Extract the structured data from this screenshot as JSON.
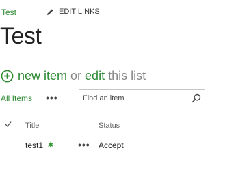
{
  "breadcrumb": {
    "site_link": "Test",
    "edit_links_label": "EDIT LINKS"
  },
  "page": {
    "title": "Test"
  },
  "command_bar": {
    "new_item_label": "new item",
    "or_text": "or",
    "edit_label": "edit",
    "this_list_label": "this list"
  },
  "views": {
    "current_view": "All Items",
    "more_label": "•••"
  },
  "search": {
    "placeholder": "Find an item"
  },
  "table": {
    "columns": [
      "Title",
      "Status"
    ],
    "rows": [
      {
        "title": "test1",
        "status": "Accept",
        "menu_label": "•••"
      }
    ]
  },
  "icons": {
    "accent": "#2f8a34",
    "add": "plus-circle-icon",
    "edit": "pencil-icon",
    "search": "magnifier-icon",
    "select_all": "checkmark-icon",
    "new_badge": "new-burst-icon"
  }
}
